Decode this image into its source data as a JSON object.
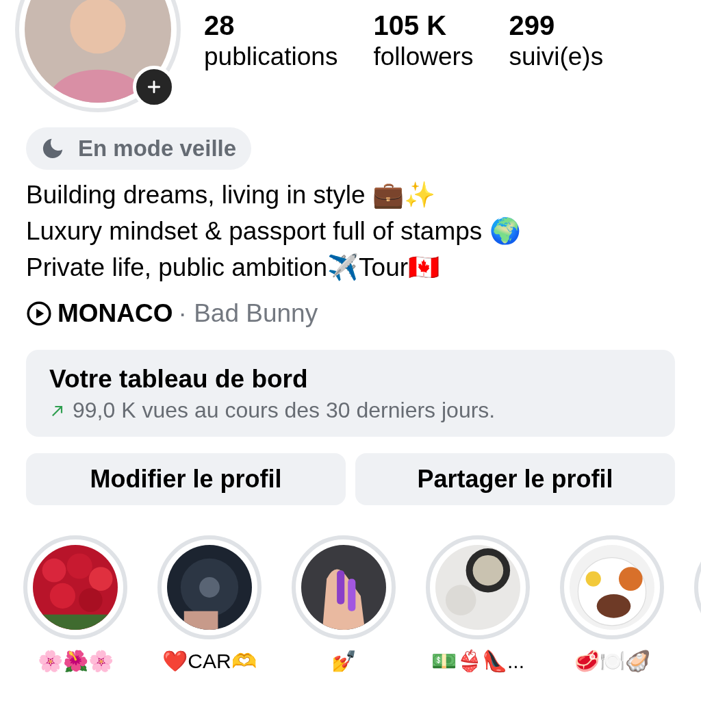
{
  "profile": {
    "has_add_story": true
  },
  "stats": [
    {
      "value": "28",
      "label": "publications"
    },
    {
      "value": "105 K",
      "label": "followers"
    },
    {
      "value": "299",
      "label": "suivi(e)s"
    }
  ],
  "status_note": {
    "text": "En mode veille"
  },
  "bio": [
    "Building dreams, living in style 💼✨",
    "Luxury mindset & passport full of stamps 🌍",
    "Private life, public ambition✈️Tour🇨🇦"
  ],
  "music": {
    "title": "MONACO",
    "artist": "· Bad Bunny"
  },
  "dashboard": {
    "title": "Votre tableau de bord",
    "subtitle": "99,0 K vues au cours des 30 derniers jours."
  },
  "buttons": [
    "Modifier le profil",
    "Partager le profil"
  ],
  "highlights": [
    {
      "label": "🌸🌺🌸",
      "kind": "picture"
    },
    {
      "label": "❤️CAR🫶",
      "kind": "picture"
    },
    {
      "label": "💅",
      "kind": "picture"
    },
    {
      "label": "💵👙👠...",
      "kind": "picture"
    },
    {
      "label": "🥩🍽️🦪",
      "kind": "picture"
    },
    {
      "kind": "cut_off"
    }
  ]
}
